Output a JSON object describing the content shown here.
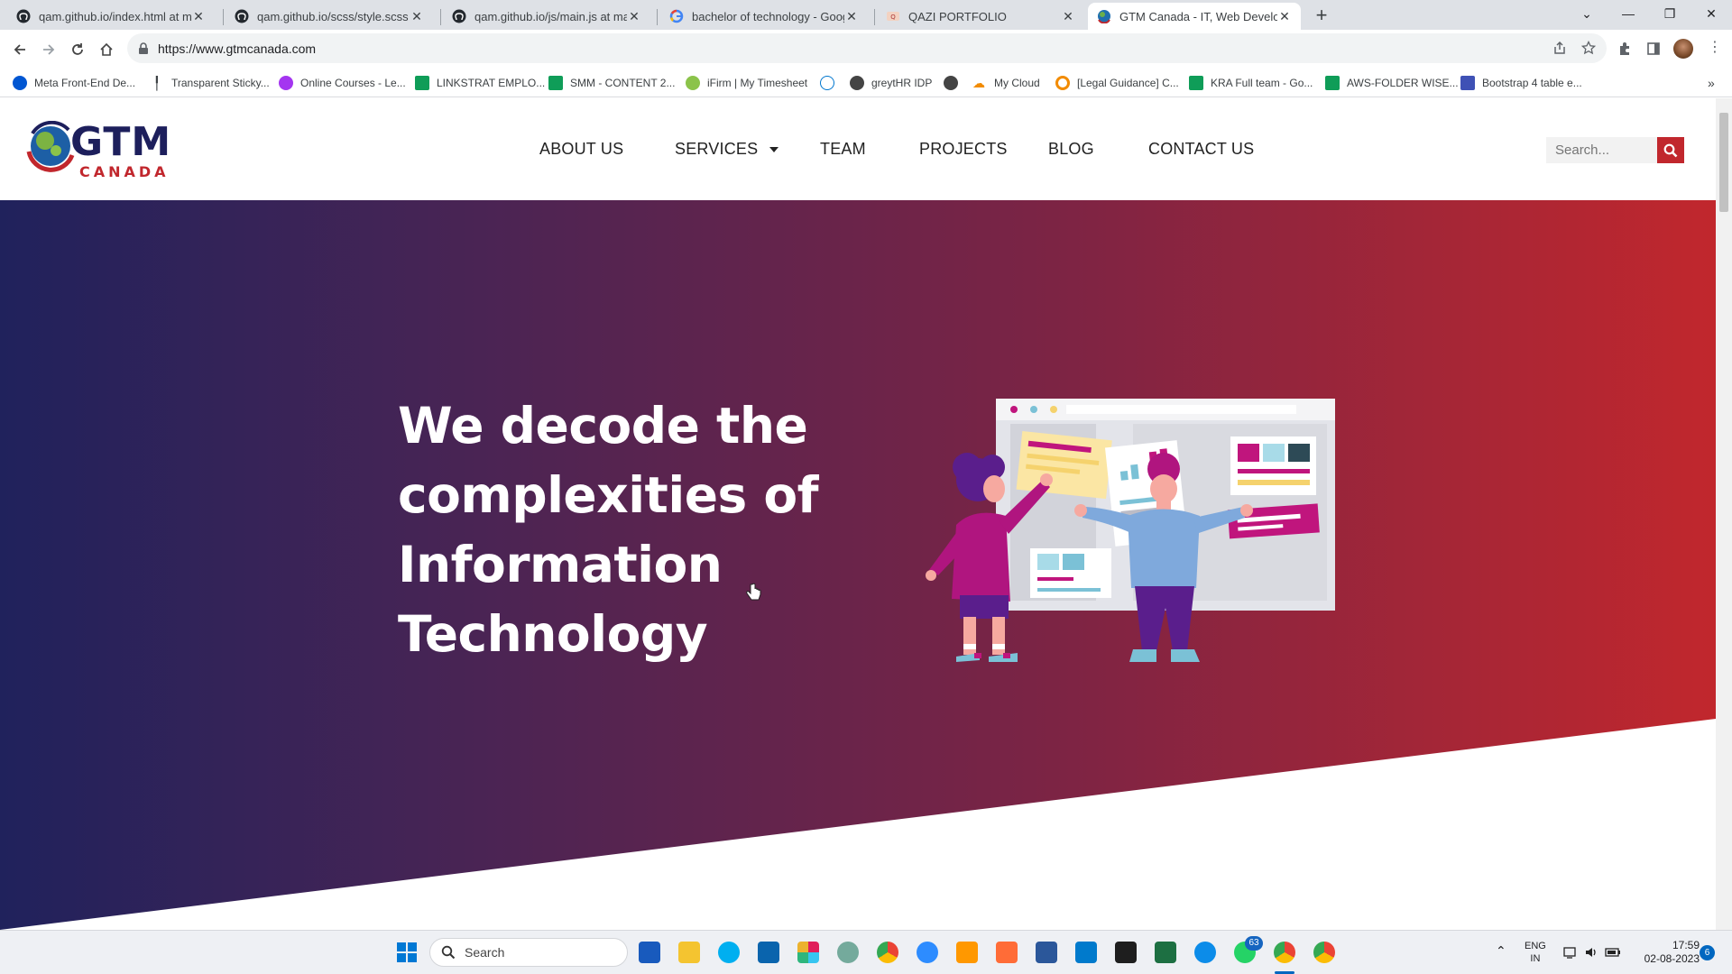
{
  "browser": {
    "tabs": [
      {
        "title": "qam.github.io/index.html at main",
        "icon": "github-icon",
        "active": false
      },
      {
        "title": "qam.github.io/scss/style.scss at m",
        "icon": "github-icon",
        "active": false
      },
      {
        "title": "qam.github.io/js/main.js at main",
        "icon": "github-icon",
        "active": false
      },
      {
        "title": "bachelor of technology - Google",
        "icon": "google-icon",
        "active": false
      },
      {
        "title": "QAZI PORTFOLIO",
        "icon": "portfolio-icon",
        "active": false
      },
      {
        "title": "GTM Canada - IT, Web Developm",
        "icon": "gtm-icon",
        "active": true
      }
    ],
    "new_tab": "+",
    "url": "https://www.gtmcanada.com",
    "bookmarks": [
      {
        "label": "Meta Front-End De...",
        "icon": "coursera-icon",
        "color": "#0056d2"
      },
      {
        "label": "Transparent Sticky...",
        "icon": "pin-icon",
        "color": "#333333"
      },
      {
        "label": "Online Courses - Le...",
        "icon": "udemy-icon",
        "color": "#a435f0"
      },
      {
        "label": "LINKSTRAT EMPLO...",
        "icon": "sheets-icon",
        "color": "#0f9d58"
      },
      {
        "label": "SMM - CONTENT 2...",
        "icon": "sheets-icon",
        "color": "#0f9d58"
      },
      {
        "label": "iFirm | My Timesheet",
        "icon": "ifirm-icon",
        "color": "#8bc34a"
      },
      {
        "label": "",
        "icon": "dell-icon",
        "color": "#0076ce"
      },
      {
        "label": "greytHR IDP",
        "icon": "globe-icon",
        "color": "#444444"
      },
      {
        "label": "",
        "icon": "globe-icon",
        "color": "#444444"
      },
      {
        "label": "My Cloud",
        "icon": "cloud-icon",
        "color": "#f28b00"
      },
      {
        "label": "[Legal Guidance] C...",
        "icon": "circle-icon",
        "color": "#f28b00"
      },
      {
        "label": "KRA Full team - Go...",
        "icon": "sheets-icon",
        "color": "#0f9d58"
      },
      {
        "label": "AWS-FOLDER WISE...",
        "icon": "sheets-icon",
        "color": "#0f9d58"
      },
      {
        "label": "Bootstrap 4 table e...",
        "icon": "mdb-icon",
        "color": "#3f51b5"
      }
    ],
    "bookmarks_more": "»"
  },
  "site": {
    "logo_gtm": "GTM",
    "logo_canada": "CANADA",
    "nav": {
      "about": "ABOUT US",
      "services": "SERVICES",
      "team": "TEAM",
      "projects": "PROJECTS",
      "blog": "BLOG",
      "contact": "CONTACT US"
    },
    "search_placeholder": "Search...",
    "hero_title": "We decode the complexities of Information Technology",
    "colors": {
      "brand_red": "#c1272d",
      "brand_navy": "#20225c"
    }
  },
  "taskbar": {
    "search_label": "Search",
    "apps": [
      "word-icon",
      "file-explorer-icon",
      "skype-icon",
      "outlook-icon",
      "slack-icon",
      "chatgpt-icon",
      "chrome-icon",
      "zoom-icon",
      "sublime-icon",
      "postman-icon",
      "notepad-icon",
      "vscode-icon",
      "terminal-icon",
      "excel-icon",
      "edge-icon",
      "whatsapp-icon",
      "chrome-icon",
      "chrome-icon"
    ],
    "whatsapp_badge": "63",
    "lang_top": "ENG",
    "lang_bottom": "IN",
    "time": "17:59",
    "date": "02-08-2023",
    "notifications": "6"
  }
}
